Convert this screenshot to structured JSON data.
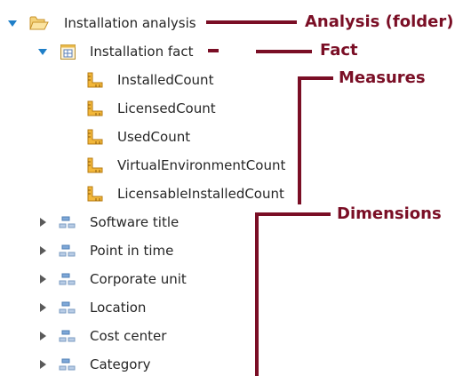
{
  "tree": {
    "root": {
      "label": "Installation analysis",
      "expanded": true,
      "icon": "folder-open-icon"
    },
    "fact": {
      "label": "Installation fact",
      "expanded": true,
      "icon": "fact-table-icon"
    },
    "measures": [
      {
        "label": "InstalledCount",
        "icon": "ruler-icon"
      },
      {
        "label": "LicensedCount",
        "icon": "ruler-icon"
      },
      {
        "label": "UsedCount",
        "icon": "ruler-icon"
      },
      {
        "label": "VirtualEnvironmentCount",
        "icon": "ruler-icon"
      },
      {
        "label": "LicensableInstalledCount",
        "icon": "ruler-icon"
      }
    ],
    "dimensions": [
      {
        "label": "Software title",
        "expanded": false,
        "icon": "dimension-icon"
      },
      {
        "label": "Point in time",
        "expanded": false,
        "icon": "dimension-icon"
      },
      {
        "label": "Corporate unit",
        "expanded": false,
        "icon": "dimension-icon"
      },
      {
        "label": "Location",
        "expanded": false,
        "icon": "dimension-icon"
      },
      {
        "label": "Cost center",
        "expanded": false,
        "icon": "dimension-icon"
      },
      {
        "label": "Category",
        "expanded": false,
        "icon": "dimension-icon"
      }
    ]
  },
  "callouts": {
    "analysis": "Analysis (folder)",
    "fact": "Fact",
    "measures": "Measures",
    "dimensions": "Dimensions"
  },
  "colors": {
    "callout": "#7a0e25",
    "expander_open": "#1f7fc8",
    "expander_closed": "#5a5a5a",
    "folder": "#e9b94a",
    "ruler": "#e2a52a",
    "dimension": "#4f87c6"
  }
}
